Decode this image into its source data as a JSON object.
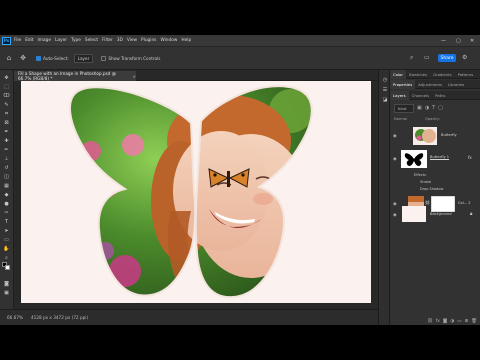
{
  "app": {
    "logo": "Ps"
  },
  "menu": {
    "items": [
      "File",
      "Edit",
      "Image",
      "Layer",
      "Type",
      "Select",
      "Filter",
      "3D",
      "View",
      "Plugins",
      "Window",
      "Help"
    ]
  },
  "window_controls": {
    "minimize": "—",
    "maximize": "▢",
    "close": "✕"
  },
  "options_bar": {
    "auto_select_label": "Auto-Select:",
    "auto_select_target": "Layer",
    "transform_controls_label": "Show Transform Controls",
    "share_label": "Share"
  },
  "document": {
    "tab_title": "Fill a Shape with an Image in Photoshop.psd @ 66.7% (RGB/8) *",
    "tab_close": "×"
  },
  "status": {
    "zoom": "66.67%",
    "size": "4128 px x 3472 px (72 ppi)"
  },
  "panels": {
    "top_tabs": [
      "Color",
      "Swatches",
      "Gradients",
      "Patterns"
    ],
    "mid_tabs": [
      "Properties",
      "Adjustments",
      "Libraries"
    ],
    "layers_tabs": [
      "Layers",
      "Channels",
      "Paths"
    ],
    "kind_label": "Kind",
    "blend_mode": "Normal",
    "opacity_label": "Opacity:"
  },
  "layers": [
    {
      "name": "Butterfly",
      "type": "photo"
    },
    {
      "name": "Butterfly 1",
      "type": "shape"
    },
    {
      "name": "Col... 2",
      "type": "fill"
    },
    {
      "name": "Background",
      "type": "background"
    }
  ],
  "effects": {
    "label": "Effects",
    "stroke": "Stroke",
    "drop_shadow": "Drop Shadow"
  },
  "colors": {
    "accent": "#1473e6",
    "ps_blue": "#31a8ff",
    "doc_bg": "#fbf1ee"
  }
}
